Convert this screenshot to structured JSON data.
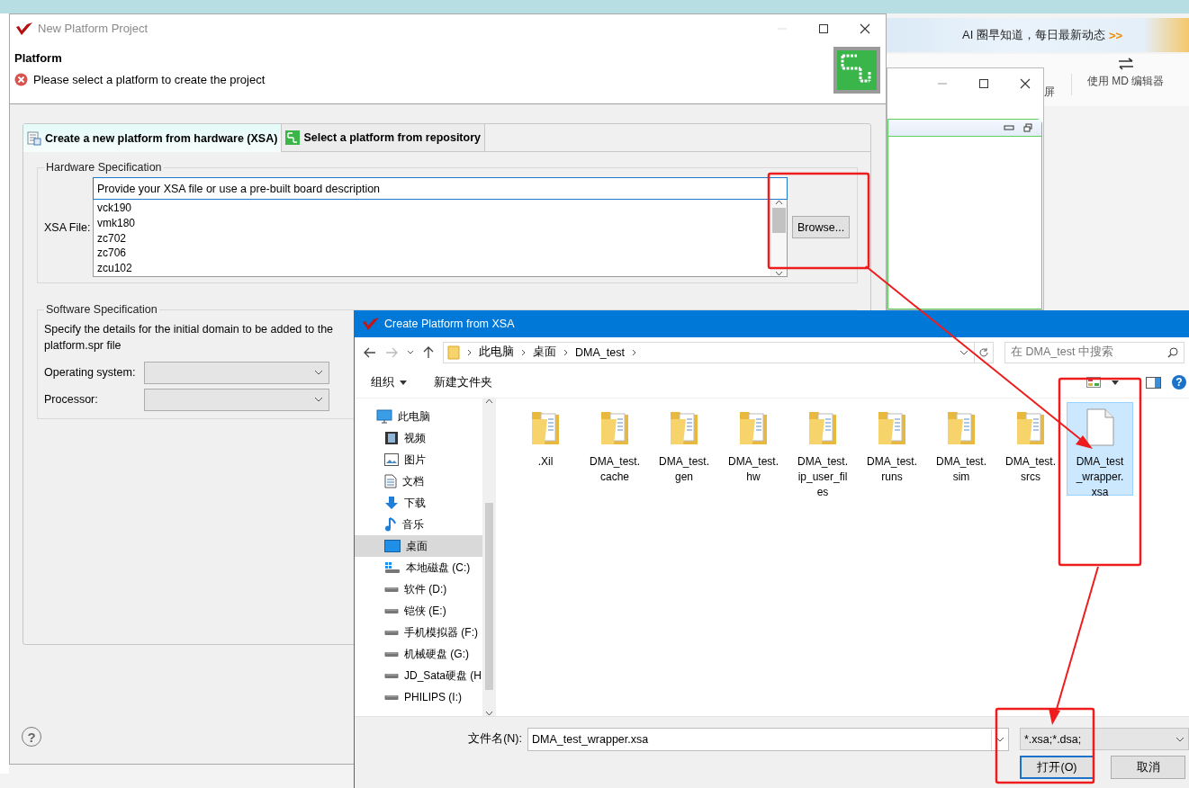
{
  "desktop": {
    "banner": {
      "text": "AI 圈早知道，每日最新动态",
      "link": ">>"
    },
    "toolbar": [
      {
        "label": "屏"
      },
      {
        "label": "使用 MD 编辑器"
      }
    ]
  },
  "platform_dialog": {
    "title": "New Platform Project",
    "header": "Platform",
    "message": "Please select a platform to create the project",
    "tabs": [
      {
        "label": "Create a new platform from hardware (XSA)",
        "selected": true
      },
      {
        "label": "Select a platform from repository",
        "selected": false
      }
    ],
    "hardware": {
      "legend": "Hardware Specification",
      "label": "XSA File:",
      "value": "Provide your XSA file or use a pre-built board description",
      "boards": [
        "vck190",
        "vmk180",
        "zc702",
        "zc706",
        "zcu102"
      ],
      "browse": "Browse..."
    },
    "software": {
      "legend": "Software Specification",
      "description": "Specify the details for the initial domain to be added to the platform.spr file",
      "fields": [
        {
          "label": "Operating system:"
        },
        {
          "label": "Processor:"
        }
      ]
    },
    "help": "?"
  },
  "file_dialog": {
    "title": "Create Platform from XSA",
    "path": [
      "此电脑",
      "桌面",
      "DMA_test"
    ],
    "search_placeholder": "在 DMA_test 中搜索",
    "toolbar": [
      {
        "label": "组织",
        "menu": true
      },
      {
        "label": "新建文件夹",
        "menu": false
      }
    ],
    "help": "?",
    "nav": [
      {
        "label": "此电脑",
        "kind": "computer",
        "selected": false,
        "children": [
          {
            "label": "视频",
            "kind": "video",
            "selected": false
          },
          {
            "label": "图片",
            "kind": "picture",
            "selected": false
          },
          {
            "label": "文档",
            "kind": "document",
            "selected": false
          },
          {
            "label": "下载",
            "kind": "download",
            "selected": false
          },
          {
            "label": "音乐",
            "kind": "music",
            "selected": false
          },
          {
            "label": "桌面",
            "kind": "desktop",
            "selected": true
          },
          {
            "label": "本地磁盘 (C:)",
            "kind": "system-drive",
            "selected": false
          },
          {
            "label": "软件 (D:)",
            "kind": "drive",
            "selected": false
          },
          {
            "label": "铠侠 (E:)",
            "kind": "drive",
            "selected": false
          },
          {
            "label": "手机模拟器 (F:)",
            "kind": "drive",
            "selected": false
          },
          {
            "label": "机械硬盘 (G:)",
            "kind": "drive",
            "selected": false
          },
          {
            "label": "JD_Sata硬盘 (H",
            "kind": "drive",
            "selected": false
          },
          {
            "label": "PHILIPS (I:)",
            "kind": "drive",
            "selected": false
          }
        ]
      }
    ],
    "files": [
      {
        "name": ".Xil",
        "kind": "folder",
        "selected": false
      },
      {
        "name": "DMA_test.cache",
        "kind": "folder",
        "selected": false
      },
      {
        "name": "DMA_test.gen",
        "kind": "folder",
        "selected": false
      },
      {
        "name": "DMA_test.hw",
        "kind": "folder",
        "selected": false
      },
      {
        "name": "DMA_test.ip_user_files",
        "kind": "folder",
        "selected": false
      },
      {
        "name": "DMA_test.runs",
        "kind": "folder",
        "selected": false
      },
      {
        "name": "DMA_test.sim",
        "kind": "folder",
        "selected": false
      },
      {
        "name": "DMA_test.srcs",
        "kind": "folder",
        "selected": false
      },
      {
        "name": "DMA_test_wrapper.xsa",
        "kind": "file",
        "selected": true
      }
    ],
    "filename_label": "文件名(N):",
    "filename": "DMA_test_wrapper.xsa",
    "filter": "*.xsa;*.dsa;",
    "buttons": [
      {
        "label": "打开(O)",
        "default": true
      },
      {
        "label": "取消",
        "default": false
      }
    ]
  }
}
